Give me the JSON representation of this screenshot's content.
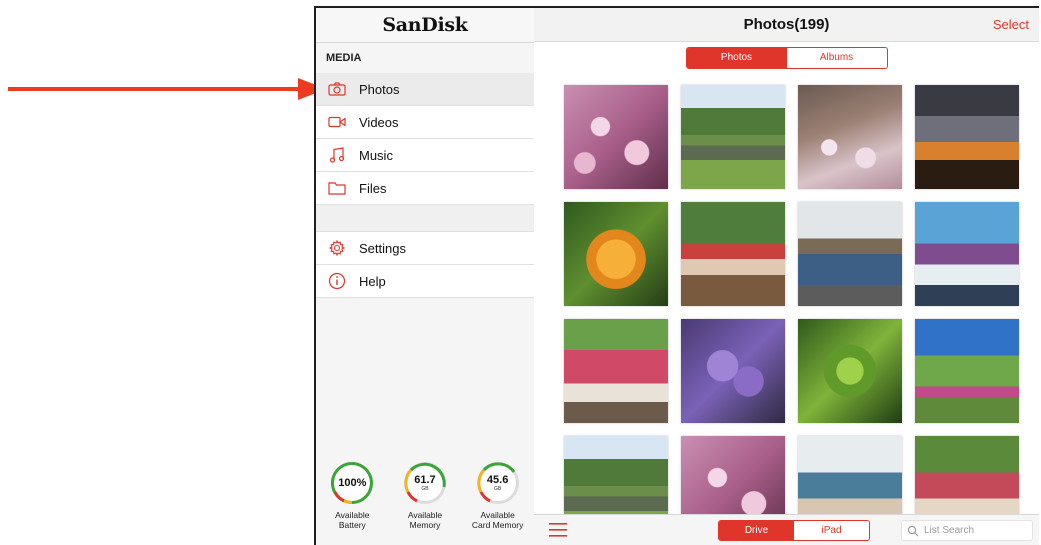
{
  "brand": "SanDisk",
  "sidebar": {
    "section_title": "MEDIA",
    "items": [
      {
        "label": "Photos",
        "icon": "camera-icon"
      },
      {
        "label": "Videos",
        "icon": "video-icon"
      },
      {
        "label": "Music",
        "icon": "music-icon"
      },
      {
        "label": "Files",
        "icon": "folder-icon"
      }
    ],
    "secondary_items": [
      {
        "label": "Settings",
        "icon": "gear-icon"
      },
      {
        "label": "Help",
        "icon": "info-icon"
      }
    ],
    "gauges": [
      {
        "value": "100%",
        "unit": "",
        "caption_line1": "Available",
        "caption_line2": "Battery",
        "level": 1.0
      },
      {
        "value": "61.7",
        "unit": "GB",
        "caption_line1": "Available",
        "caption_line2": "Memory",
        "level": 0.78
      },
      {
        "value": "45.6",
        "unit": "GB",
        "caption_line1": "Available",
        "caption_line2": "Card Memory",
        "level": 0.7
      }
    ]
  },
  "header": {
    "title": "Photos(199)",
    "select_label": "Select"
  },
  "tabs": {
    "photos_label": "Photos",
    "albums_label": "Albums",
    "active": "Photos"
  },
  "bottom": {
    "drive_label": "Drive",
    "ipad_label": "iPad",
    "active": "Drive",
    "search_placeholder": "List Search"
  },
  "colors": {
    "accent": "#e0352b",
    "arrow": "#ee3a1e"
  }
}
